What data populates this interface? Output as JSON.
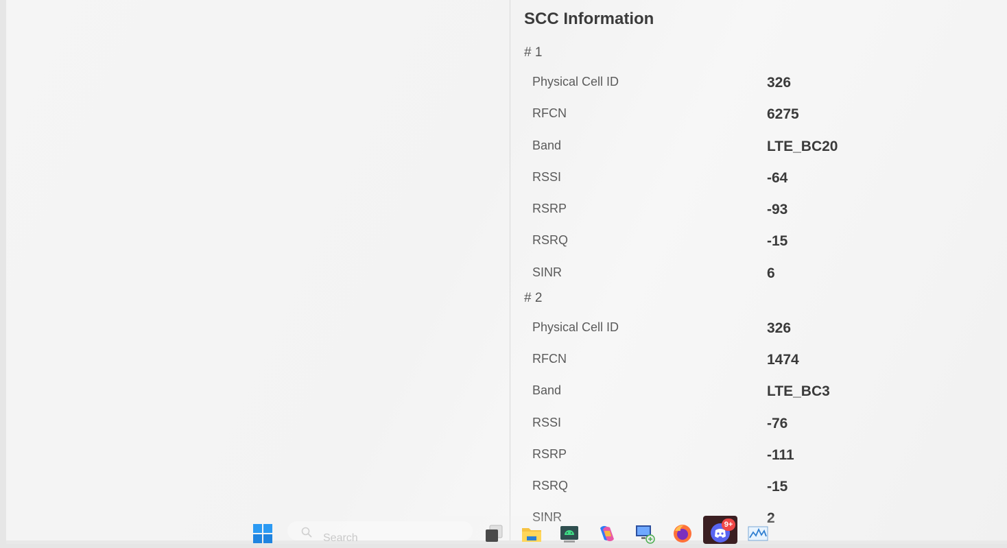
{
  "title": "SCC Information",
  "groups": [
    {
      "heading": "# 1",
      "rows": [
        {
          "label": "Physical Cell ID",
          "value": "326"
        },
        {
          "label": "RFCN",
          "value": "6275"
        },
        {
          "label": "Band",
          "value": "LTE_BC20"
        },
        {
          "label": "RSSI",
          "value": "-64"
        },
        {
          "label": "RSRP",
          "value": "-93"
        },
        {
          "label": "RSRQ",
          "value": "-15"
        },
        {
          "label": "SINR",
          "value": "6"
        }
      ]
    },
    {
      "heading": "# 2",
      "rows": [
        {
          "label": "Physical Cell ID",
          "value": "326"
        },
        {
          "label": "RFCN",
          "value": "1474"
        },
        {
          "label": "Band",
          "value": "LTE_BC3"
        },
        {
          "label": "RSSI",
          "value": "-76"
        },
        {
          "label": "RSRP",
          "value": "-111"
        },
        {
          "label": "RSRQ",
          "value": "-15"
        },
        {
          "label": "SINR",
          "value": "2"
        }
      ]
    }
  ],
  "taskbar": {
    "search_placeholder": "Search",
    "discord_badge": "9+",
    "icons": [
      "windows-start-icon",
      "search-icon",
      "task-view-icon",
      "file-explorer-icon",
      "android-studio-icon",
      "copilot-icon",
      "remote-desktop-icon",
      "firefox-icon",
      "discord-icon",
      "resource-monitor-icon"
    ]
  },
  "colors": {
    "background": "#f3f3f3",
    "heading_text": "#3b3b3b",
    "label_text": "#5a5a5a",
    "value_text": "#3a3a3a",
    "windows_blue": "#1e90ff",
    "discord_badge": "#f04747"
  }
}
